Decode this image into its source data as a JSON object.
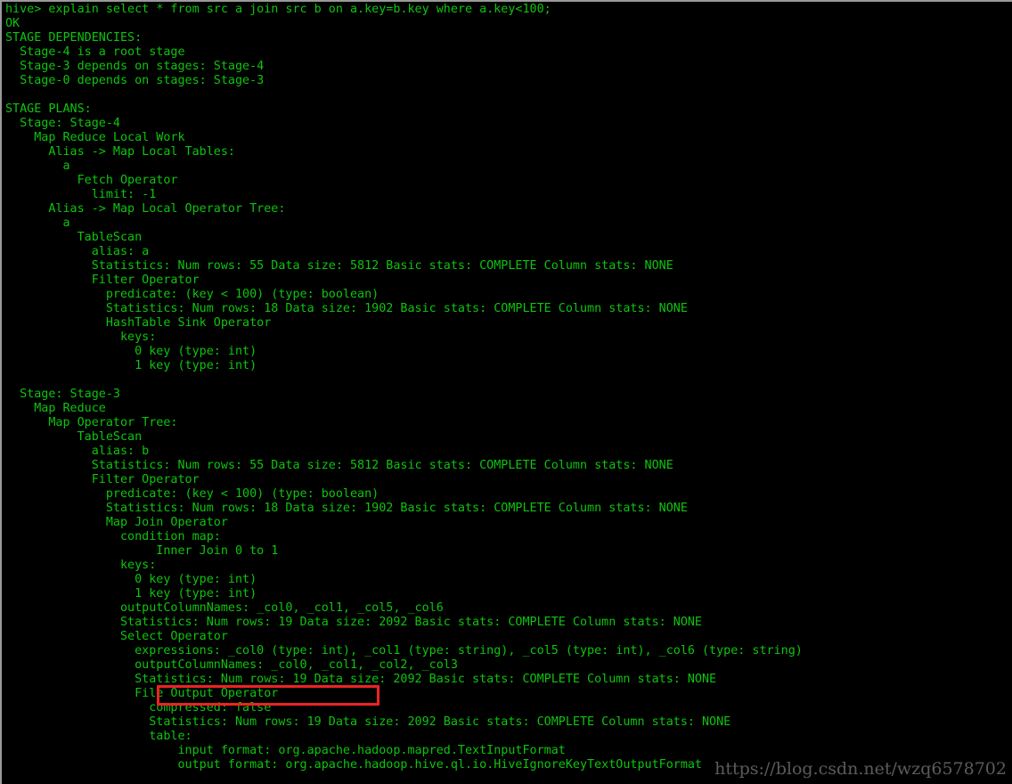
{
  "terminal": {
    "shell_prompt": "hive>",
    "foreground_color": "#0ec40e",
    "background_color": "#000000",
    "border_color": "#9a9a9a",
    "command": "hive> explain select * from src a join src b on a.key=b.key where a.key<100;",
    "lines": [
      "hive> explain select * from src a join src b on a.key=b.key where a.key<100;",
      "OK",
      "STAGE DEPENDENCIES:",
      "  Stage-4 is a root stage",
      "  Stage-3 depends on stages: Stage-4",
      "  Stage-0 depends on stages: Stage-3",
      "",
      "STAGE PLANS:",
      "  Stage: Stage-4",
      "    Map Reduce Local Work",
      "      Alias -> Map Local Tables:",
      "        a",
      "          Fetch Operator",
      "            limit: -1",
      "      Alias -> Map Local Operator Tree:",
      "        a",
      "          TableScan",
      "            alias: a",
      "            Statistics: Num rows: 55 Data size: 5812 Basic stats: COMPLETE Column stats: NONE",
      "            Filter Operator",
      "              predicate: (key < 100) (type: boolean)",
      "              Statistics: Num rows: 18 Data size: 1902 Basic stats: COMPLETE Column stats: NONE",
      "              HashTable Sink Operator",
      "                keys:",
      "                  0 key (type: int)",
      "                  1 key (type: int)",
      "",
      "  Stage: Stage-3",
      "    Map Reduce",
      "      Map Operator Tree:",
      "          TableScan",
      "            alias: b",
      "            Statistics: Num rows: 55 Data size: 5812 Basic stats: COMPLETE Column stats: NONE",
      "            Filter Operator",
      "              predicate: (key < 100) (type: boolean)",
      "              Statistics: Num rows: 18 Data size: 1902 Basic stats: COMPLETE Column stats: NONE",
      "              Map Join Operator",
      "                condition map:",
      "                     Inner Join 0 to 1",
      "                keys:",
      "                  0 key (type: int)",
      "                  1 key (type: int)",
      "                outputColumnNames: _col0, _col1, _col5, _col6",
      "                Statistics: Num rows: 19 Data size: 2092 Basic stats: COMPLETE Column stats: NONE",
      "                Select Operator",
      "                  expressions: _col0 (type: int), _col1 (type: string), _col5 (type: int), _col6 (type: string)",
      "                  outputColumnNames: _col0, _col1, _col2, _col3",
      "                  Statistics: Num rows: 19 Data size: 2092 Basic stats: COMPLETE Column stats: NONE",
      "                  File Output Operator",
      "                    compressed: false",
      "                    Statistics: Num rows: 19 Data size: 2092 Basic stats: COMPLETE Column stats: NONE",
      "                    table:",
      "                        input format: org.apache.hadoop.mapred.TextInputFormat",
      "                        output format: org.apache.hadoop.hive.ql.io.HiveIgnoreKeyTextOutputFormat"
    ]
  },
  "annotation": {
    "highlight_label": "File Output Operator",
    "highlight_color": "#ee2222"
  },
  "watermark": {
    "text": "https://blog.csdn.net/wzq6578702",
    "color": "#e1e1e1"
  }
}
